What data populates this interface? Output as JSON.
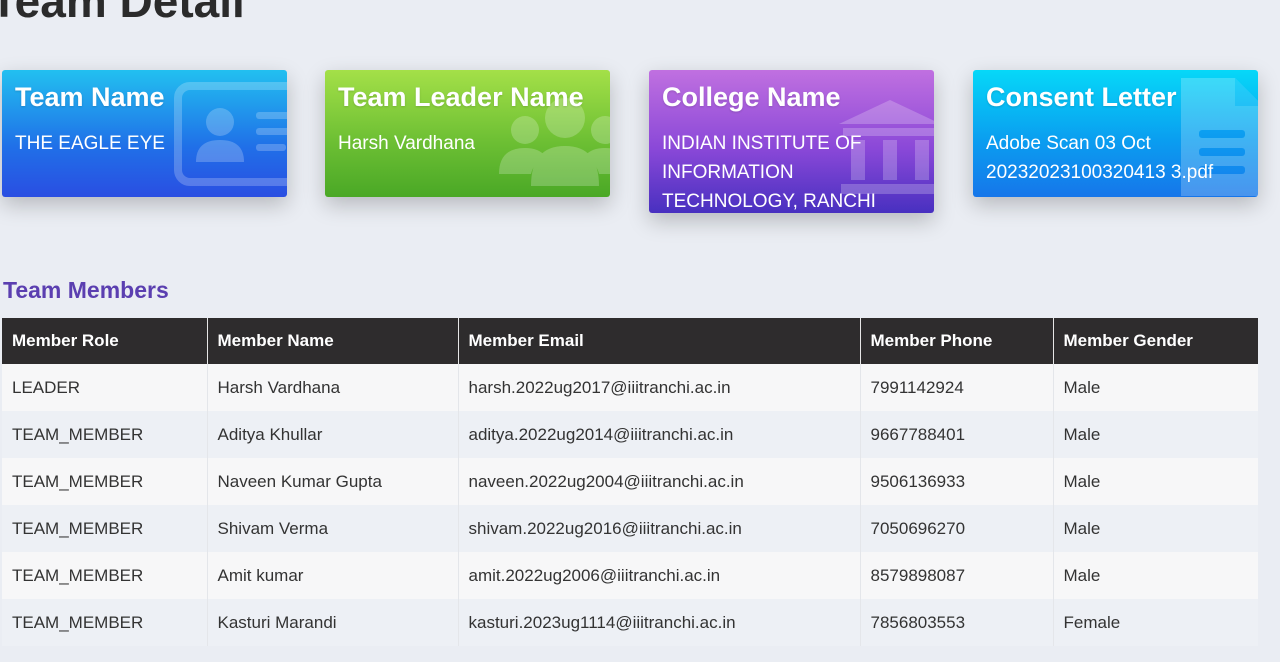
{
  "page": {
    "title": "Team Detail"
  },
  "cards": {
    "team_name": {
      "title": "Team Name",
      "value": "THE EAGLE EYE",
      "icon": "id-card-icon"
    },
    "team_leader": {
      "title": "Team Leader Name",
      "value": "Harsh Vardhana",
      "icon": "users-icon"
    },
    "college": {
      "title": "College Name",
      "value": "INDIAN INSTITUTE OF INFORMATION TECHNOLOGY, RANCHI",
      "icon": "institution-icon"
    },
    "consent": {
      "title": "Consent Letter",
      "value": "Adobe Scan 03 Oct 20232023100320413 3.pdf",
      "icon": "document-icon"
    }
  },
  "members_section": {
    "heading": "Team Members",
    "headers": [
      "Member Role",
      "Member Name",
      "Member Email",
      "Member Phone",
      "Member Gender"
    ],
    "rows": [
      [
        "LEADER",
        "Harsh Vardhana",
        "harsh.2022ug2017@iiitranchi.ac.in",
        "7991142924",
        "Male"
      ],
      [
        "TEAM_MEMBER",
        "Aditya Khullar",
        "aditya.2022ug2014@iiitranchi.ac.in",
        "9667788401",
        "Male"
      ],
      [
        "TEAM_MEMBER",
        "Naveen Kumar Gupta",
        "naveen.2022ug2004@iiitranchi.ac.in",
        "9506136933",
        "Male"
      ],
      [
        "TEAM_MEMBER",
        "Shivam Verma",
        "shivam.2022ug2016@iiitranchi.ac.in",
        "7050696270",
        "Male"
      ],
      [
        "TEAM_MEMBER",
        "Amit kumar",
        "amit.2022ug2006@iiitranchi.ac.in",
        "8579898087",
        "Male"
      ],
      [
        "TEAM_MEMBER",
        "Kasturi Marandi",
        "kasturi.2023ug1114@iiitranchi.ac.in",
        "7856803553",
        "Female"
      ]
    ]
  },
  "colors": {
    "background": "#eaedf3",
    "heading_accent": "#5b3fb0",
    "table_header": "#2e2c2d"
  }
}
